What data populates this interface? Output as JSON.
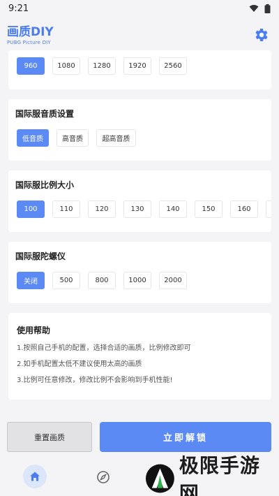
{
  "status_bar": {
    "time": "9:21"
  },
  "header": {
    "title": "画质DIY",
    "subtitle": "PUBG Picture DIY"
  },
  "resolution": {
    "options": [
      "960",
      "1080",
      "1280",
      "1920",
      "2560"
    ],
    "selected": "960"
  },
  "audio": {
    "title": "国际服音质设置",
    "options": [
      "低音质",
      "高音质",
      "超高音质"
    ],
    "selected": "低音质"
  },
  "ratio": {
    "title": "国际服比例大小",
    "options": [
      "100",
      "110",
      "120",
      "130",
      "140",
      "150",
      "160"
    ],
    "selected": "100"
  },
  "gyro": {
    "title": "国际服陀螺仪",
    "options": [
      "关闭",
      "500",
      "800",
      "1000",
      "2000"
    ],
    "selected": "关闭"
  },
  "help": {
    "title": "使用帮助",
    "lines": [
      "1.按照自己手机的配置，选择合适的画质，比例修改即可",
      "2.如手机配置太低不建议使用太高的画质",
      "3.比例可任意修改，修改比例不会影响到手机性能!"
    ]
  },
  "buttons": {
    "reset": "重置画质",
    "unlock": "立即解锁"
  },
  "watermark": {
    "text": "极限手游网"
  },
  "colors": {
    "accent": "#5b8af5",
    "title": "#4b7df0"
  }
}
